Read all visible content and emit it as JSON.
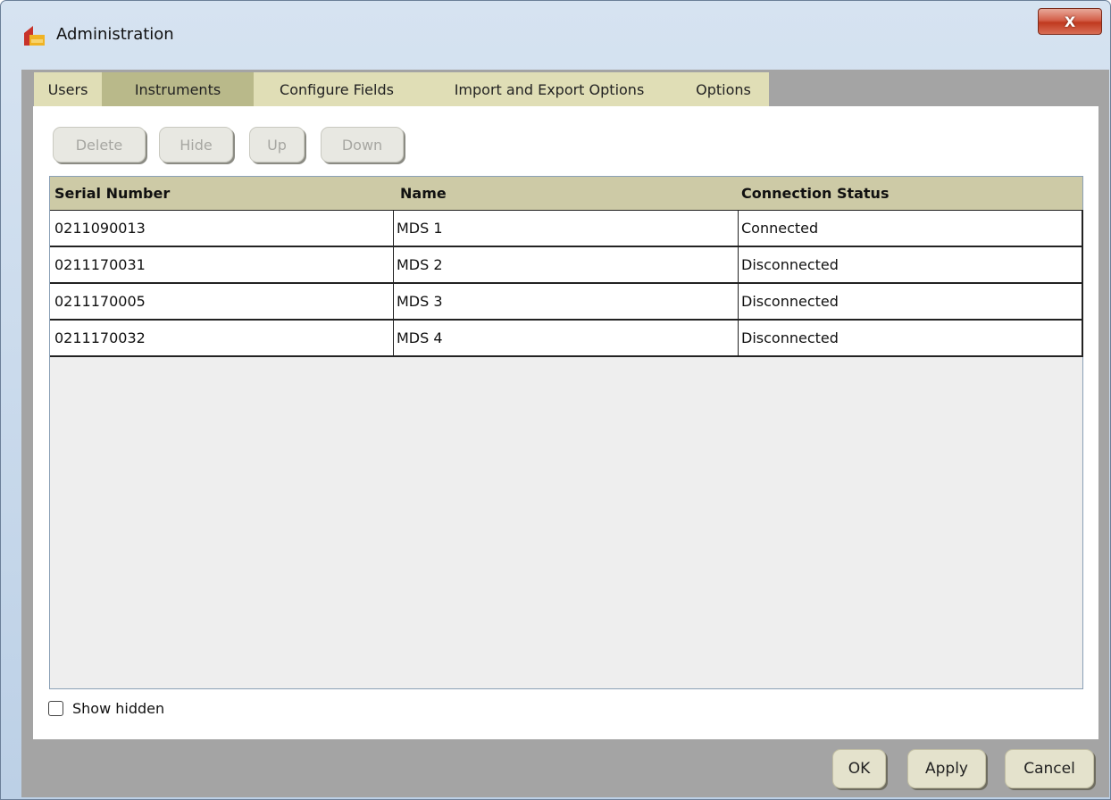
{
  "window": {
    "title": "Administration",
    "close_label": "X"
  },
  "tabs": [
    {
      "label": "Users",
      "active": false
    },
    {
      "label": "Instruments",
      "active": true
    },
    {
      "label": "Configure Fields",
      "active": false
    },
    {
      "label": "Import and Export Options",
      "active": false
    },
    {
      "label": "Options",
      "active": false
    }
  ],
  "toolbar": {
    "delete_label": "Delete",
    "hide_label": "Hide",
    "up_label": "Up",
    "down_label": "Down",
    "enabled": false
  },
  "table": {
    "columns": [
      "Serial Number",
      "Name",
      "Connection Status"
    ],
    "rows": [
      [
        "0211090013",
        "MDS 1",
        "Connected"
      ],
      [
        "0211170031",
        "MDS 2",
        "Disconnected"
      ],
      [
        "0211170005",
        "MDS 3",
        "Disconnected"
      ],
      [
        "0211170032",
        "MDS 4",
        "Disconnected"
      ]
    ]
  },
  "show_hidden": {
    "label": "Show hidden",
    "checked": false
  },
  "footer": {
    "ok_label": "OK",
    "apply_label": "Apply",
    "cancel_label": "Cancel"
  },
  "colors": {
    "accent_tab": "#b9b98a",
    "header_row": "#cdcaa6",
    "close_button": "#c0391f"
  }
}
